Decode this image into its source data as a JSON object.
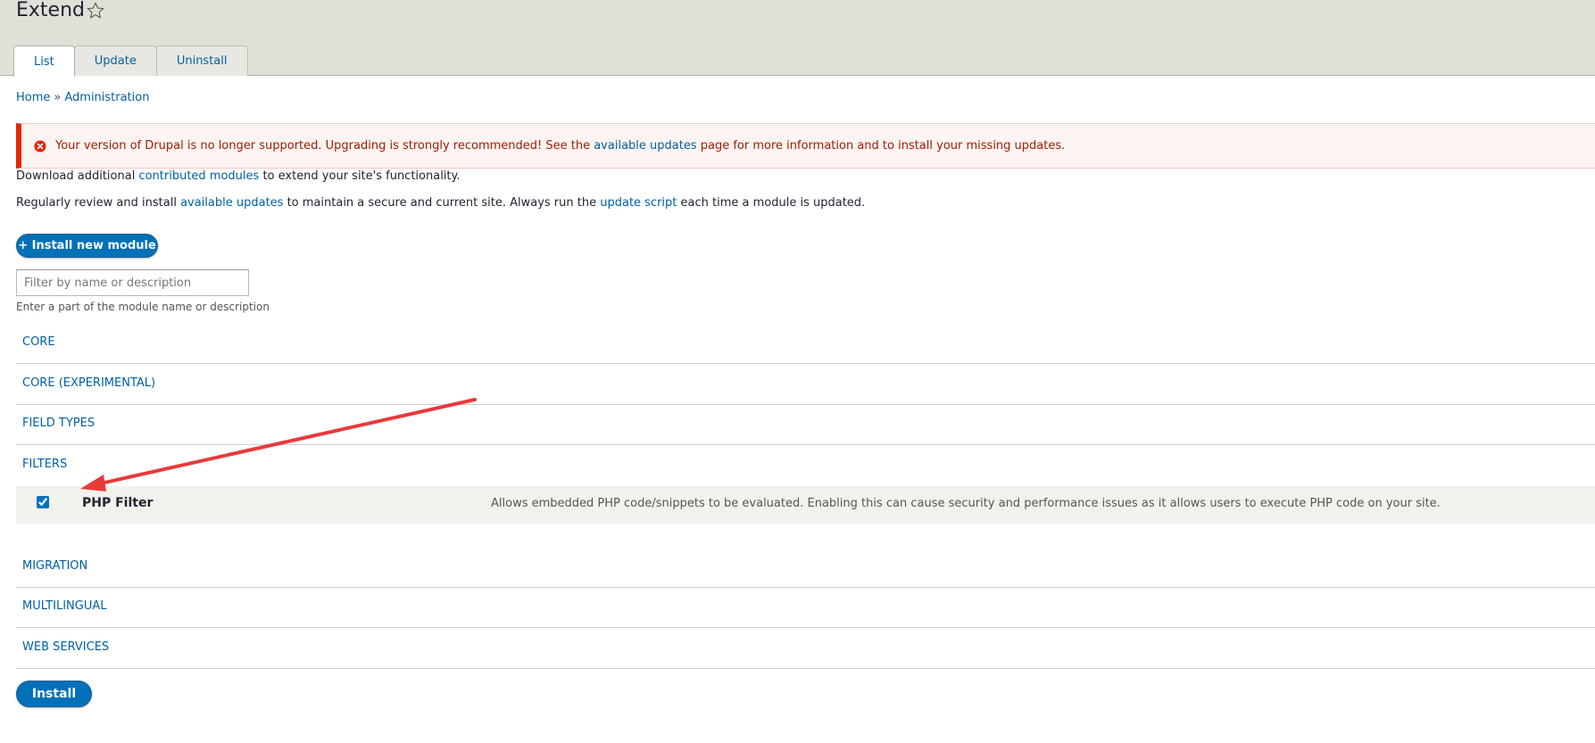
{
  "page": {
    "title": "Extend",
    "star_icon": "star-outline-icon"
  },
  "tabs": [
    {
      "label": "List",
      "active": true
    },
    {
      "label": "Update",
      "active": false
    },
    {
      "label": "Uninstall",
      "active": false
    }
  ],
  "breadcrumb": {
    "home": "Home",
    "separator": "»",
    "admin": "Administration"
  },
  "error_message": {
    "icon": "error-circle-icon",
    "text_before": "Your version of Drupal is no longer supported. Upgrading is strongly recommended! See the ",
    "link": "available updates",
    "text_after": " page for more information and to install your missing updates.",
    "color": "#a51b00"
  },
  "intro": {
    "line1_before": "Download additional ",
    "line1_link": "contributed modules",
    "line1_after": " to extend your site's functionality.",
    "line2_before": "Regularly review and install ",
    "line2_link1": "available updates",
    "line2_mid": " to maintain a secure and current site. Always run the ",
    "line2_link2": "update script",
    "line2_after": " each time a module is updated."
  },
  "install_new_button": "+ Install new module",
  "filter": {
    "placeholder": "Filter by name or description",
    "value": "",
    "description": "Enter a part of the module name or description"
  },
  "packages": [
    {
      "label": "CORE"
    },
    {
      "label": "CORE (EXPERIMENTAL)"
    },
    {
      "label": "FIELD TYPES"
    },
    {
      "label": "FILTERS"
    },
    {
      "label": "MIGRATION"
    },
    {
      "label": "MULTILINGUAL"
    },
    {
      "label": "WEB SERVICES"
    }
  ],
  "module": {
    "name": "PHP Filter",
    "checked": true,
    "description": "Allows embedded PHP code/snippets to be evaluated. Enabling this can cause security and performance issues as it allows users to execute PHP code on your site."
  },
  "install_button": "Install",
  "colors": {
    "link": "#0060a5",
    "primary": "#0071b8",
    "error": "#e32700",
    "annotation_arrow": "#e8393a"
  }
}
